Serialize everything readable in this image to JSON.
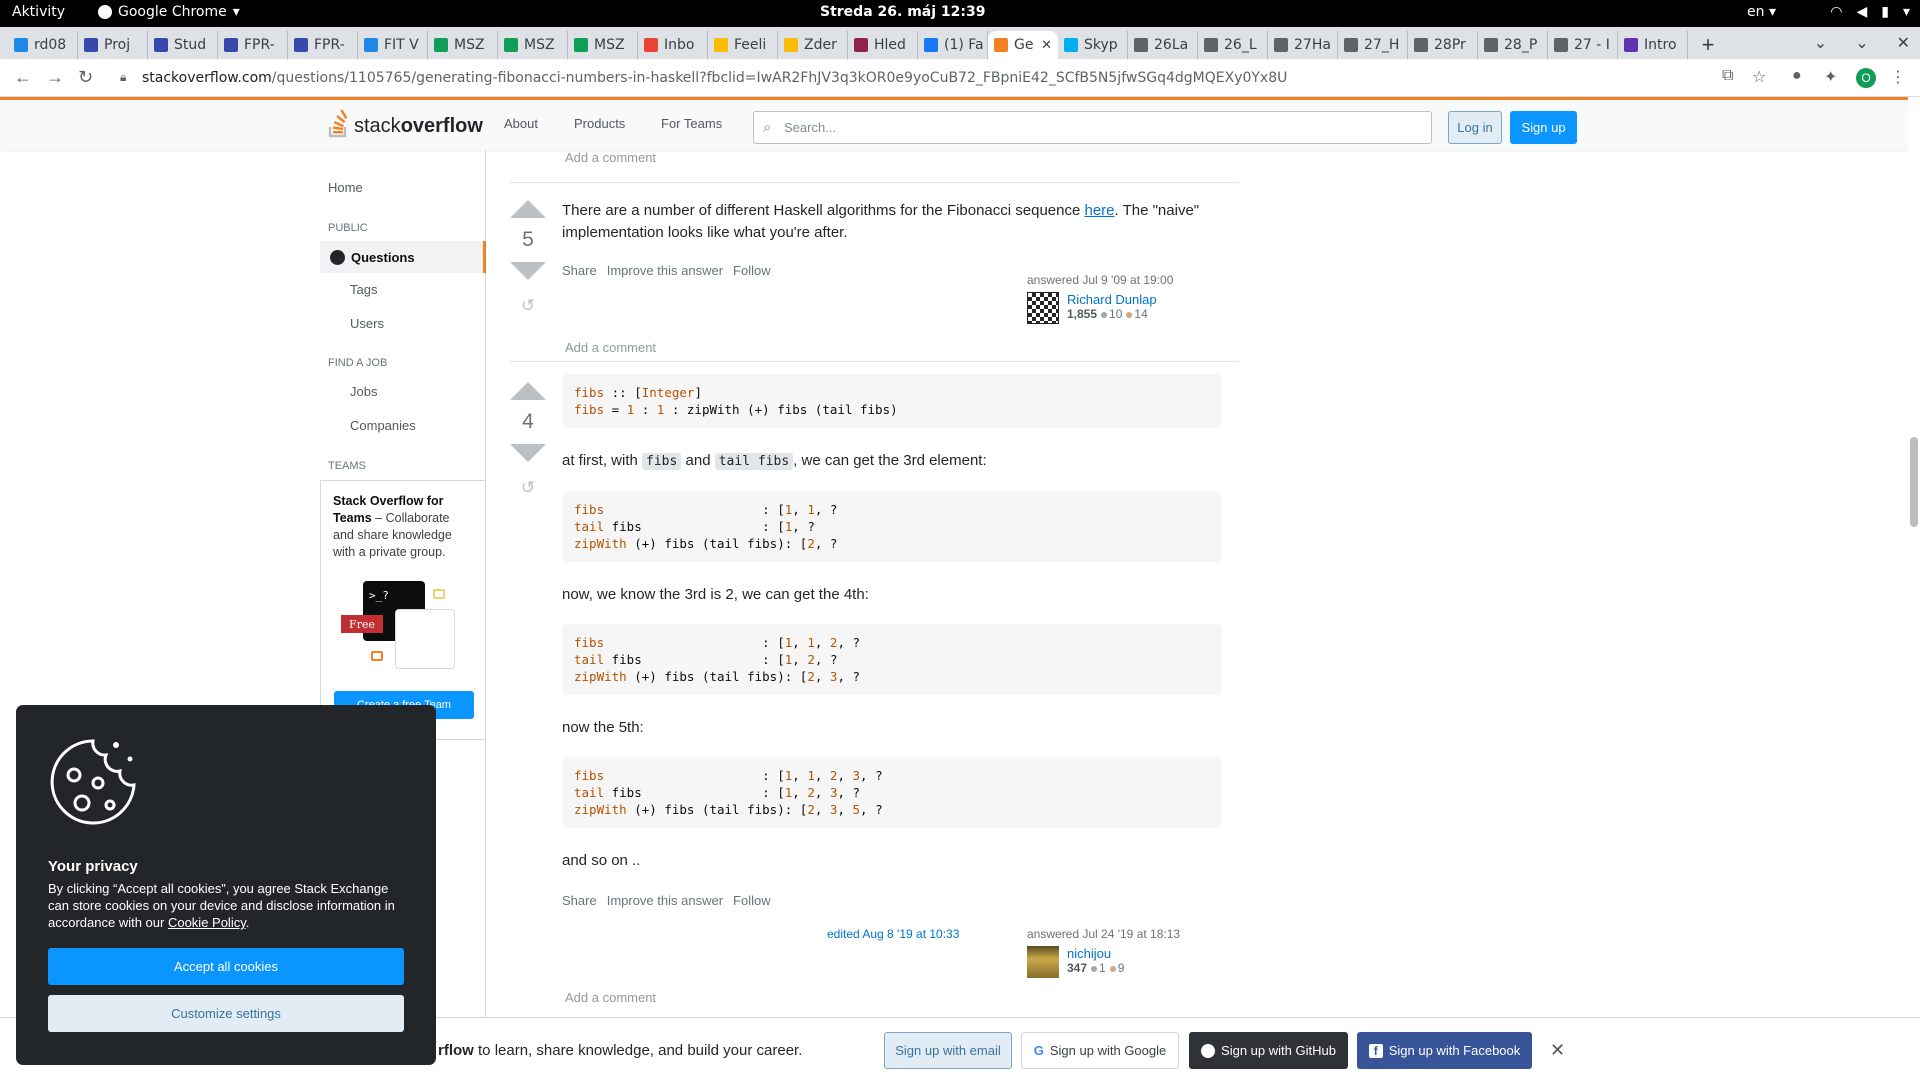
{
  "os": {
    "activities": "Aktivity",
    "app_name": "Google Chrome",
    "clock": "Streda 26. máj  12:39",
    "lang": "en"
  },
  "tabs": [
    {
      "label": "rd08",
      "color": "#1e88e5"
    },
    {
      "label": "Proj",
      "color": "#3949ab"
    },
    {
      "label": "Stud",
      "color": "#3949ab"
    },
    {
      "label": "FPR-",
      "color": "#3949ab"
    },
    {
      "label": "FPR-",
      "color": "#3949ab"
    },
    {
      "label": "FIT V",
      "color": "#1e88e5"
    },
    {
      "label": "MSZ",
      "color": "#0f9d58"
    },
    {
      "label": "MSZ",
      "color": "#0f9d58"
    },
    {
      "label": "MSZ",
      "color": "#0f9d58"
    },
    {
      "label": "Inbo",
      "color": "#ea4335"
    },
    {
      "label": "Feeli",
      "color": "#fbbc04"
    },
    {
      "label": "Zder",
      "color": "#fbbc04"
    },
    {
      "label": "Hled",
      "color": "#8e244d"
    },
    {
      "label": "(1) Fa",
      "color": "#1877f2"
    },
    {
      "label": "Ge",
      "color": "#f48024",
      "active": true
    },
    {
      "label": "Skyp",
      "color": "#00aff0"
    },
    {
      "label": "26La",
      "color": "#5f6368"
    },
    {
      "label": "26_L",
      "color": "#5f6368"
    },
    {
      "label": "27Ha",
      "color": "#5f6368"
    },
    {
      "label": "27_H",
      "color": "#5f6368"
    },
    {
      "label": "28Pr",
      "color": "#5f6368"
    },
    {
      "label": "28_P",
      "color": "#5f6368"
    },
    {
      "label": "27 - I",
      "color": "#5f6368"
    },
    {
      "label": "Intro",
      "color": "#5e35b1"
    }
  ],
  "address": {
    "domain": "stackoverflow.com",
    "path": "/questions/1105765/generating-fibonacci-numbers-in-haskell?fbclid=IwAR2FhJV3q3kOR0e9yoCuB72_FBpniE42_SCfB5N5jfwSGq4dgMQEXy0Yx8U"
  },
  "so": {
    "logo_a": "stack",
    "logo_b": "overflow",
    "nav": [
      "About",
      "Products",
      "For Teams"
    ],
    "search_placeholder": "Search...",
    "login": "Log in",
    "signup": "Sign up"
  },
  "leftnav": {
    "home": "Home",
    "public": "PUBLIC",
    "questions": "Questions",
    "tags": "Tags",
    "users": "Users",
    "find_job": "FIND A JOB",
    "jobs": "Jobs",
    "companies": "Companies",
    "teams": "TEAMS",
    "teams_title": "Stack Overflow for Teams",
    "teams_desc": " – Collaborate and share knowledge with a private group.",
    "free": "Free",
    "cta": "Create a free Team",
    "cta_suffix": "?"
  },
  "add_comment": "Add a comment",
  "answer1": {
    "votes": "5",
    "text_a": "There are a number of different Haskell algorithms for the Fibonacci sequence ",
    "link": "here",
    "text_b": ". The \"naive\" implementation looks like what you're after.",
    "menu": [
      "Share",
      "Improve this answer",
      "Follow"
    ],
    "answered": "answered Jul 9 '09 at 19:00",
    "user": "Richard Dunlap",
    "rep": "1,855",
    "silver": "10",
    "bronze": "14"
  },
  "answer2": {
    "votes": "4",
    "code1_l1_a": "fibs",
    "code1_l1_b": " :: [",
    "code1_l1_c": "Integer",
    "code1_l1_d": "]",
    "code1_l2_a": "fibs",
    "code1_l2_b": " = ",
    "code1_l2_c": "1",
    "code1_l2_d": " : ",
    "code1_l2_e": "1",
    "code1_l2_f": " : zipWith (+) fibs (tail fibs)",
    "p1_a": "at first, with ",
    "p1_code1": "fibs",
    "p1_b": " and ",
    "p1_code2": "tail fibs",
    "p1_c": ", we can get the 3rd element:",
    "p2": "now, we know the 3rd is 2, we can get the 4th:",
    "p3": "now the 5th:",
    "p4": "and so on ..",
    "lbl_fibs": "fibs",
    "lbl_tail": "tail",
    "lbl_tail_rest": " fibs",
    "lbl_zip": "zipWith",
    "lbl_zip_rest": " (+) fibs (tail fibs)",
    "t1_row1_pad": "                     : [",
    "t1_row2_pad": "                : [",
    "t1_row3_pad": ": [",
    "t1_fibs": [
      "1",
      "1"
    ],
    "t1_tail": [
      "1"
    ],
    "t1_zip": [
      "2"
    ],
    "t2_fibs": [
      "1",
      "1",
      "2"
    ],
    "t2_tail": [
      "1",
      "2"
    ],
    "t2_zip": [
      "2",
      "3"
    ],
    "t3_fibs": [
      "1",
      "1",
      "2",
      "3"
    ],
    "t3_tail": [
      "1",
      "2",
      "3"
    ],
    "t3_zip": [
      "2",
      "3",
      "5"
    ],
    "menu": [
      "Share",
      "Improve this answer",
      "Follow"
    ],
    "edited": "edited Aug 8 '19 at 10:33",
    "answered": "answered Jul 24 '19 at 18:13",
    "user": "nichijou",
    "rep": "347",
    "silver": "1",
    "bronze": "9"
  },
  "cookie": {
    "title": "Your privacy",
    "body": "By clicking “Accept all cookies”, you agree Stack Exchange can store cookies on your device and disclose information in accordance with our ",
    "link": "Cookie Policy",
    "body_end": ".",
    "accept": "Accept all cookies",
    "customize": "Customize settings"
  },
  "signupbar": {
    "text_bold": "rflow",
    "text": " to learn, share knowledge, and build your career.",
    "email": "Sign up with email",
    "google": "Sign up with Google",
    "github": "Sign up with GitHub",
    "facebook": "Sign up with Facebook"
  },
  "colors": {
    "accent": "#f48024",
    "link": "#0074cc",
    "primary_button": "#0a95ff"
  }
}
